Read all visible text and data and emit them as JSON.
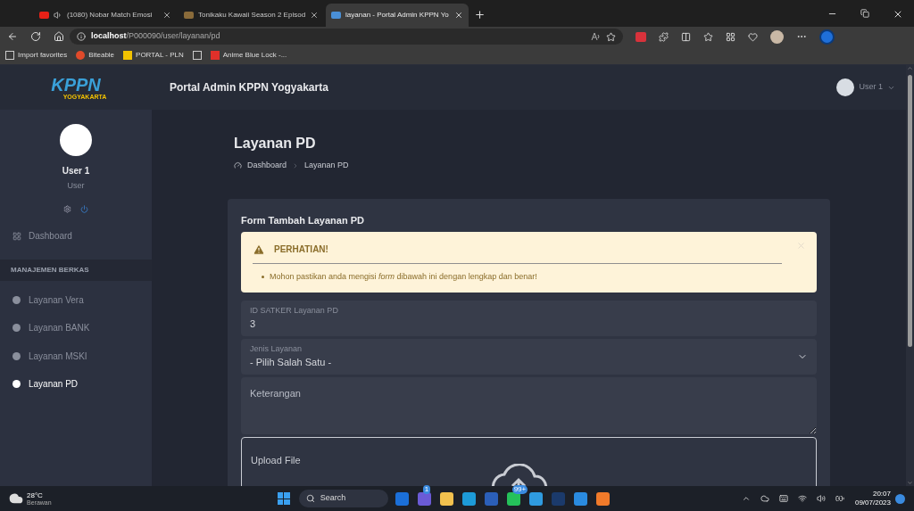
{
  "browser": {
    "tabs": [
      {
        "title": "(1080) Nobar Match Emosi",
        "selected": false,
        "kind": "video"
      },
      {
        "title": "Tonikaku Kawaii Season 2 Episod",
        "selected": false,
        "kind": "anime"
      },
      {
        "title": "layanan - Portal Admin KPPN Yo",
        "selected": true,
        "kind": "site"
      }
    ],
    "address": {
      "host": "localhost",
      "path": "/P000090/user/layanan/pd"
    },
    "bookmarks": [
      {
        "label": "Import favorites",
        "kind": "import"
      },
      {
        "label": "Biteable",
        "kind": "biteable"
      },
      {
        "label": "PORTAL - PLN",
        "kind": "pln"
      },
      {
        "kind": "page"
      },
      {
        "label": "Anime Blue Lock -...",
        "kind": "anime"
      }
    ]
  },
  "app": {
    "logo": {
      "main": "KPPN",
      "sub": "YOGYAKARTA"
    },
    "title": "Portal Admin KPPN Yogyakarta",
    "user_menu": "User 1",
    "sidebar": {
      "user_name": "User 1",
      "role": "User",
      "top_items": [
        {
          "label": "Dashboard",
          "selected": false
        }
      ],
      "section": "MANAJEMEN BERKAS",
      "items": [
        {
          "label": "Layanan Vera",
          "selected": false
        },
        {
          "label": "Layanan BANK",
          "selected": false
        },
        {
          "label": "Layanan MSKI",
          "selected": false
        },
        {
          "label": "Layanan PD",
          "selected": true
        }
      ]
    },
    "page": {
      "title": "Layanan PD",
      "breadcrumb": [
        "Dashboard",
        "Layanan PD"
      ],
      "form": {
        "title": "Form Tambah Layanan PD",
        "alert": {
          "title": "PERHATIAN!",
          "items": [
            "Mohon pastikan anda mengisi *form* dibawah ini dengan lengkap dan benar!"
          ]
        },
        "fields": [
          {
            "kind": "input",
            "label": "ID SATKER Layanan PD",
            "value": "3"
          },
          {
            "kind": "select",
            "label": "Jenis Layanan",
            "value": "- Pilih Salah Satu -"
          },
          {
            "kind": "textarea",
            "placeholder": "Keterangan"
          },
          {
            "kind": "upload",
            "label": "Upload File"
          }
        ]
      }
    }
  },
  "taskbar": {
    "weather": {
      "temp": "28°C",
      "condition": "Berawan"
    },
    "search": {
      "placeholder": "Search"
    },
    "apps": [
      {
        "kind": "copilot"
      },
      {
        "kind": "chat",
        "badge": "1"
      },
      {
        "kind": "folder"
      },
      {
        "kind": "edge"
      },
      {
        "kind": "word"
      },
      {
        "kind": "whatsapp",
        "badge": "99+"
      },
      {
        "kind": "transfer"
      },
      {
        "kind": "steam"
      },
      {
        "kind": "vscode"
      },
      {
        "kind": "xampp"
      }
    ],
    "time": "20:07",
    "date": "09/07/2023"
  }
}
